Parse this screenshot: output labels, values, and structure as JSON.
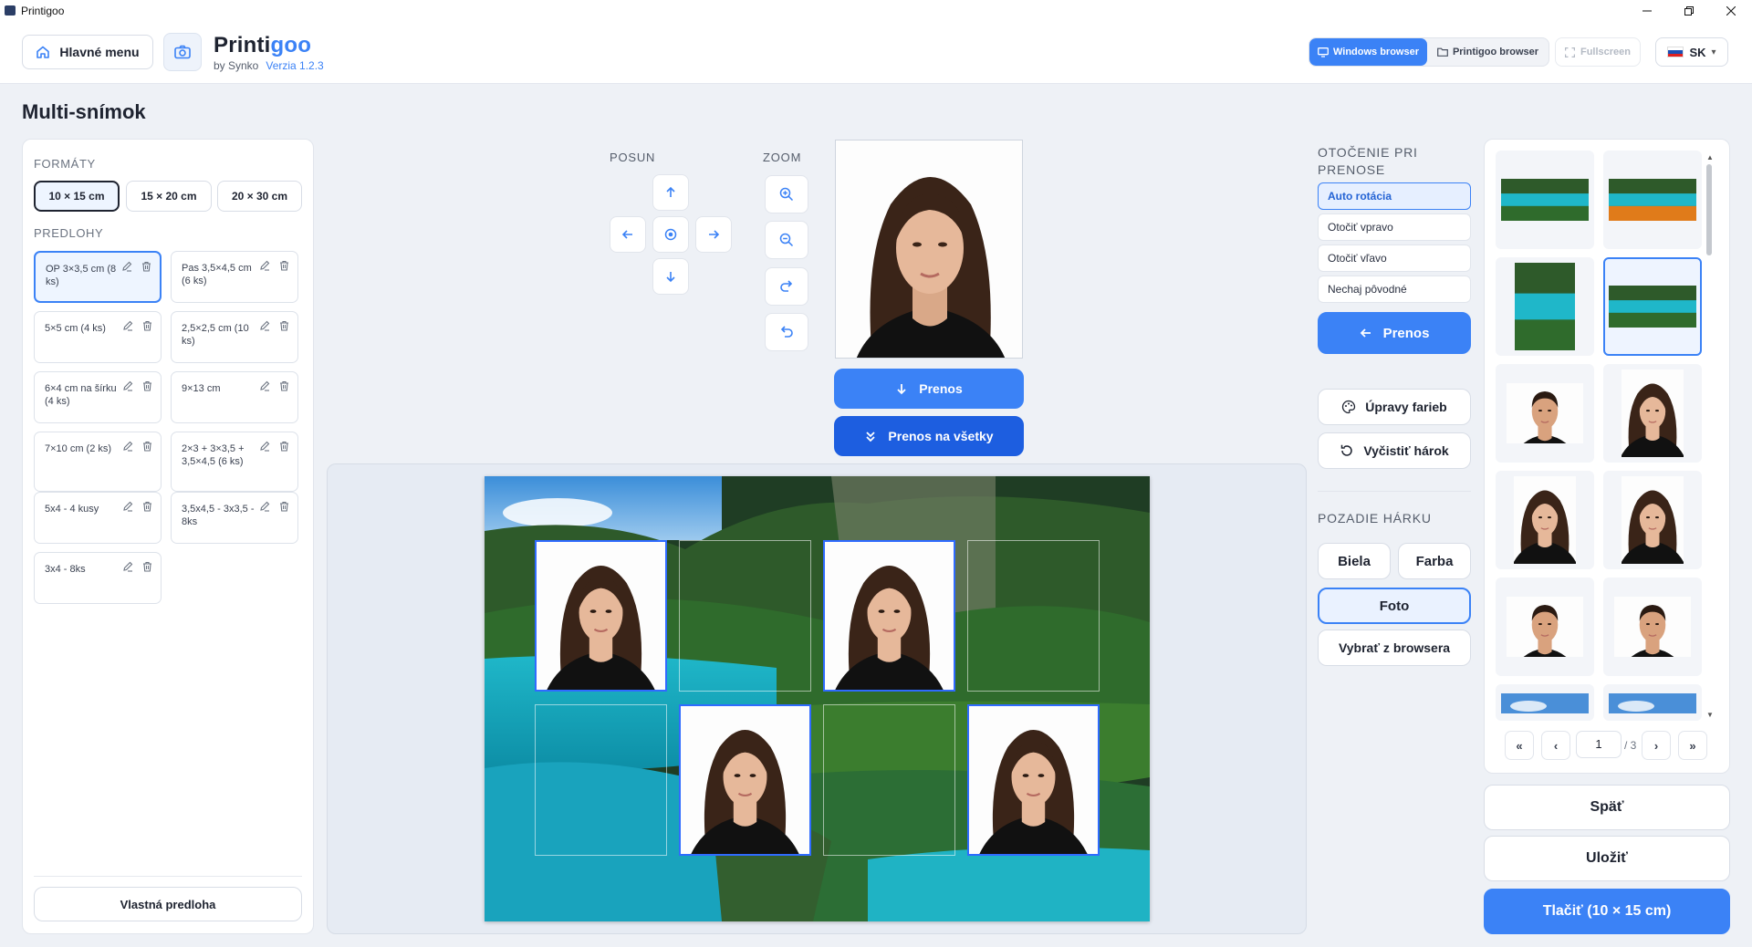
{
  "window": {
    "title": "Printigoo"
  },
  "header": {
    "home_label": "Hlavné menu",
    "brand_name_a": "Printi",
    "brand_name_b": "goo",
    "brand_by": "by Synko",
    "brand_version": "Verzia 1.2.3",
    "windows_browser": "Windows browser",
    "printigoo_browser": "Printigoo browser",
    "fullscreen": "Fullscreen",
    "lang": "SK"
  },
  "page_title": "Multi-snímok",
  "formats": {
    "label": "FORMÁTY",
    "items": [
      "10 × 15 cm",
      "15 × 20 cm",
      "20 × 30 cm"
    ],
    "selected": 0
  },
  "templates": {
    "label": "PREDLOHY",
    "items": [
      "OP 3×3,5 cm (8 ks)",
      "Pas 3,5×4,5 cm (6 ks)",
      "5×5 cm (4 ks)",
      "2,5×2,5 cm (10 ks)",
      "6×4 cm na šírku (4 ks)",
      "9×13 cm",
      "7×10 cm (2 ks)",
      "2×3 + 3×3,5 + 3,5×4,5 (6 ks)",
      "5x4 - 4 kusy",
      "3,5x4,5 - 3x3,5 - 8ks",
      "3x4 - 8ks"
    ],
    "selected": 0,
    "custom_label": "Vlastná predloha"
  },
  "controls": {
    "posun_label": "POSUN",
    "zoom_label": "ZOOM",
    "prenos_label": "Prenos",
    "prenos_all_label": "Prenos na všetky"
  },
  "rotation": {
    "label": "OTOČENIE PRI PRENOSE",
    "options": [
      "Auto rotácia",
      "Otočiť vpravo",
      "Otočiť vľavo",
      "Nechaj pôvodné"
    ],
    "selected": 0,
    "prenos_label": "Prenos"
  },
  "actions": {
    "colors_label": "Úpravy farieb",
    "clear_label": "Vyčistiť hárok"
  },
  "background": {
    "label": "POZADIE HÁRKU",
    "white": "Biela",
    "color": "Farba",
    "photo": "Foto",
    "browser": "Vybrať z browsera",
    "selected": "Foto"
  },
  "gallery": {
    "page": "1",
    "total": "/ 3",
    "first": "«",
    "prev": "‹",
    "next": "›",
    "last": "»",
    "selected_index": 3
  },
  "bottom": {
    "back": "Späť",
    "save": "Uložiť",
    "print": "Tlačiť (10 × 15 cm)"
  },
  "colors": {
    "accent": "#3b82f6",
    "accent_dark": "#1d5ee0"
  }
}
